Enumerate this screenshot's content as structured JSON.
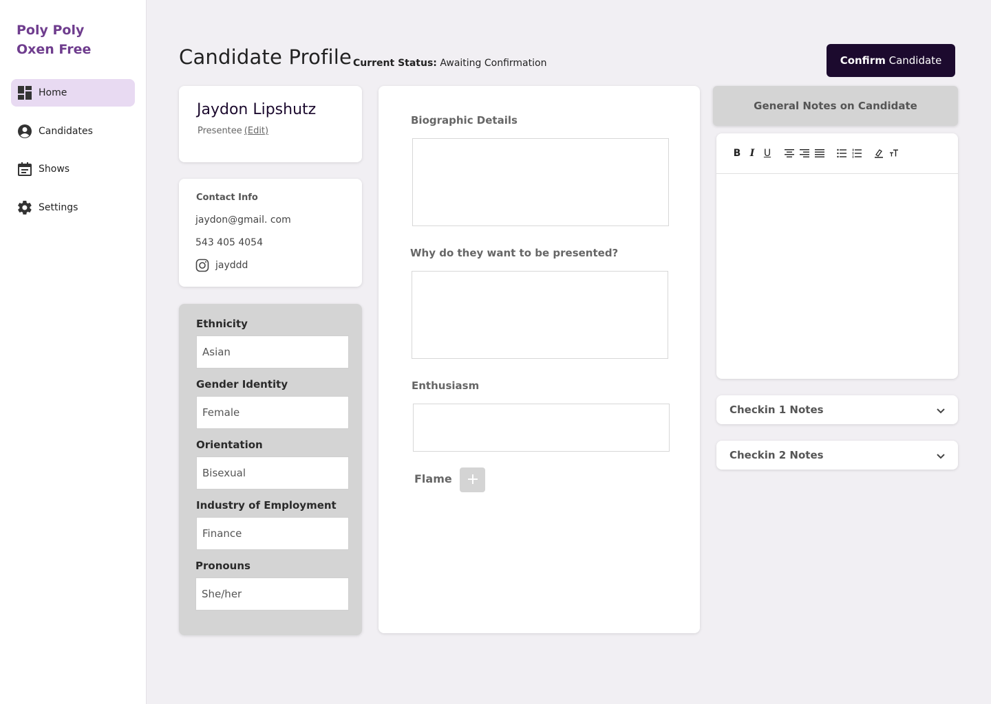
{
  "sidebar": {
    "brand": "Poly Poly Oxen Free",
    "items": [
      {
        "label": "Home",
        "icon": "dashboard-icon",
        "active": true
      },
      {
        "label": "Candidates",
        "icon": "account-circle-icon",
        "active": false
      },
      {
        "label": "Shows",
        "icon": "calendar-icon",
        "active": false
      },
      {
        "label": "Settings",
        "icon": "gear-icon",
        "active": false
      }
    ]
  },
  "header": {
    "title": "Candidate Profile",
    "status_key": "Current Status:",
    "status_value": "Awaiting Confirmation",
    "confirm_bold": "Confirm",
    "confirm_rest": "Candidate"
  },
  "candidate": {
    "name": "Jaydon Lipshutz",
    "role": "Presentee",
    "edit_label": "(Edit)"
  },
  "contact": {
    "title": "Contact Info",
    "email": "jaydon@gmail. com",
    "phone": "543 405 4054",
    "instagram": "jayddd"
  },
  "demographics": [
    {
      "label": "Ethnicity",
      "value": "Asian"
    },
    {
      "label": "Gender Identity",
      "value": "Female"
    },
    {
      "label": "Orientation",
      "value": "Bisexual"
    },
    {
      "label": "Industry of Employment",
      "value": "Finance"
    },
    {
      "label": "Pronouns",
      "value": "She/her"
    }
  ],
  "middle": {
    "bio_label": "Biographic Details",
    "why_label": "Why do they want to be presented?",
    "enthusiasm_label": "Enthusiasm",
    "flame_label": "Flame"
  },
  "notes": {
    "general_title": "General Notes on Candidate",
    "toolbar": [
      "B",
      "I",
      "U"
    ],
    "checkin1": "Checkin 1 Notes",
    "checkin2": "Checkin 2 Notes"
  },
  "colors": {
    "brand": "#6f3d8e",
    "primary_button": "#1c0a2e",
    "active_nav": "#e8daf2",
    "panel_gray": "#d4d4d4",
    "background": "#f1eff3"
  }
}
